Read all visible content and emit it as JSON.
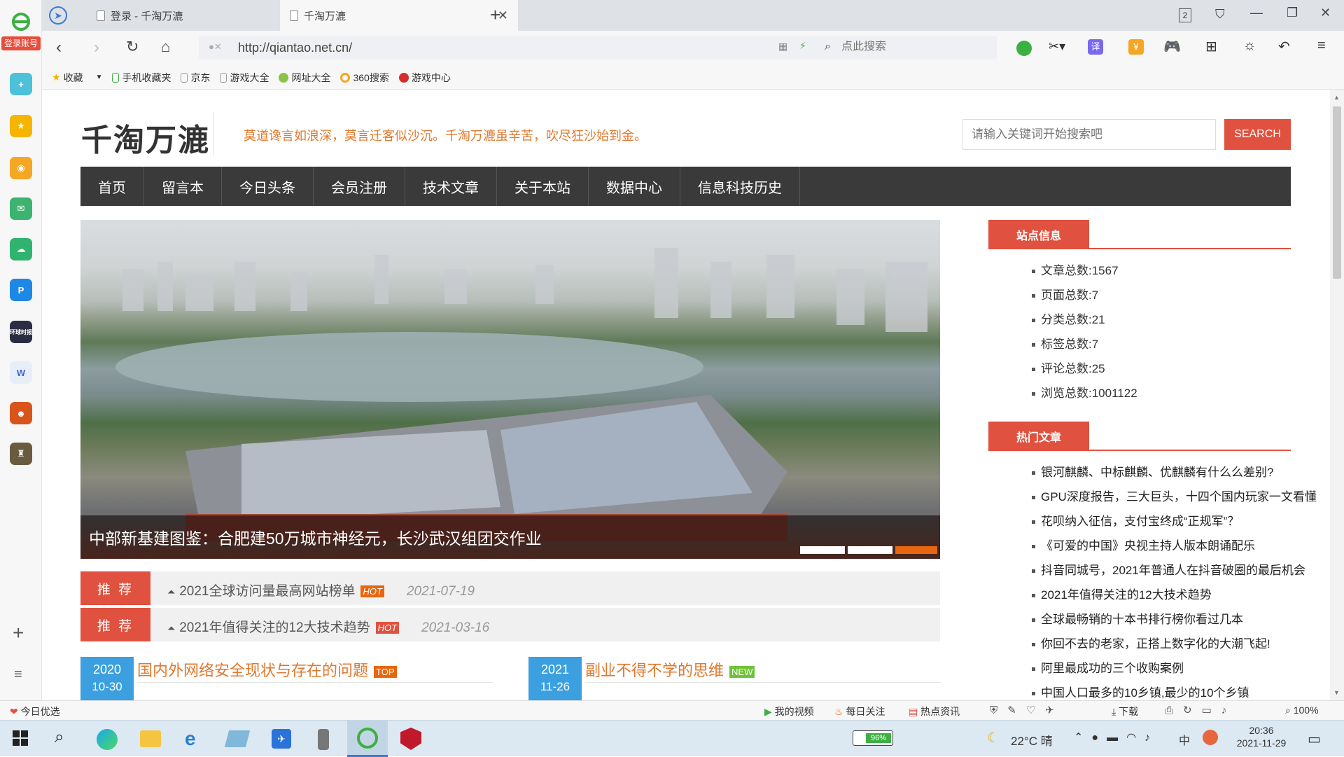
{
  "browser": {
    "login_label": "登录账号",
    "tabs": [
      {
        "title": "登录 - 千淘万漉"
      },
      {
        "title": "千淘万漉"
      }
    ],
    "tab_counter": "2",
    "url": "http://qiantao.net.cn/",
    "search_placeholder": "点此搜索",
    "bookmarks": [
      "收藏",
      "手机收藏夹",
      "京东",
      "游戏大全",
      "网址大全",
      "360搜索",
      "游戏中心"
    ],
    "left_icons": [
      "add-icon",
      "star-icon",
      "weibo-icon",
      "mail-icon",
      "cloud-icon",
      "p-icon",
      "news-icon",
      "doc-icon",
      "game-icon",
      "avatar-icon"
    ],
    "left_news_label": "环球时报",
    "statusbar": {
      "left": "今日优选",
      "items": [
        "我的视频",
        "每日关注",
        "热点资讯"
      ],
      "download": "下载",
      "zoom": "100%"
    },
    "taskbar": {
      "battery": "96%",
      "weather": "22°C 晴",
      "time": "20:36",
      "date": "2021-11-29",
      "ime": "中"
    },
    "colors": {
      "accent": "#e0513f",
      "nav": "#3a3a3a"
    }
  },
  "site": {
    "logo": "千淘万漉",
    "slogan": "莫道谗言如浪深，莫言迁客似沙沉。千淘万漉虽辛苦，吹尽狂沙始到金。",
    "search_placeholder": "请输入关键词开始搜索吧",
    "search_button": "SEARCH",
    "nav": [
      "首页",
      "留言本",
      "今日头条",
      "会员注册",
      "技术文章",
      "关于本站",
      "数据中心",
      "信息科技历史"
    ],
    "slider_caption": "中部新基建图鉴：合肥建50万城市神经元，长沙武汉组团交作业",
    "slider_active_dot": 3,
    "recommend": [
      {
        "badge": "推 荐",
        "title": "2021全球访问量最高网站榜单",
        "tag": "HOT",
        "date": "2021-07-19"
      },
      {
        "badge": "推 荐",
        "title": "2021年值得关注的12大技术趋势",
        "tag": "HOT",
        "date": "2021-03-16"
      }
    ],
    "posts": [
      {
        "year": "2020",
        "md": "10-30",
        "title": "国内外网络安全现状与存在的问题",
        "tag": "TOP"
      },
      {
        "year": "2021",
        "md": "11-26",
        "title": "副业不得不学的思维",
        "tag": "NEW"
      }
    ],
    "sidebar": {
      "info_title": "站点信息",
      "stats": [
        "文章总数:1567",
        "页面总数:7",
        "分类总数:21",
        "标签总数:7",
        "评论总数:25",
        "浏览总数:1001122"
      ],
      "hot_title": "热门文章",
      "hot": [
        "银河麒麟、中标麒麟、优麒麟有什么么差别?",
        "GPU深度报告，三大巨头，十四个国内玩家一文看懂",
        "花呗纳入征信，支付宝终成“正规军”？",
        "《可爱的中国》央视主持人版本朗诵配乐",
        "抖音同城号，2021年普通人在抖音破圈的最后机会",
        "2021年值得关注的12大技术趋势",
        "全球最畅销的十本书排行榜你看过几本",
        "你回不去的老家，正搭上数字化的大潮飞起!",
        "阿里最成功的三个收购案例",
        "中国人口最多的10乡镇,最少的10个乡镇"
      ]
    }
  }
}
